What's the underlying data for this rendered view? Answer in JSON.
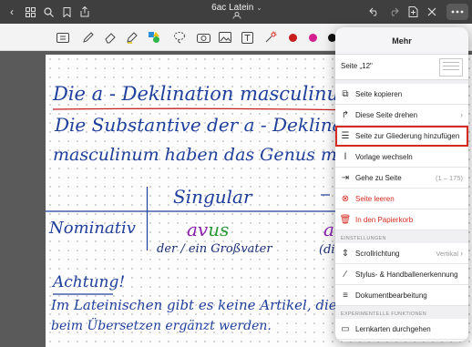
{
  "app": {
    "title": "6ac Latein",
    "title_caret": "⌄",
    "subtitle_icon": "cloud-person-icon"
  },
  "topbar": {
    "left_icons": [
      "back-icon",
      "grid-icon",
      "search-icon",
      "bookmark-icon",
      "share-icon"
    ],
    "right_icons": [
      "undo-icon",
      "redo-icon",
      "add-page-icon",
      "close-icon",
      "more-icon"
    ]
  },
  "toolbar": {
    "tools": [
      "read-mode-icon",
      "pen-icon",
      "eraser-icon",
      "highlighter-icon",
      "shape-icon",
      "lasso-icon",
      "camera-icon",
      "image-icon",
      "text-icon",
      "laser-icon"
    ],
    "colors": [
      "#c81e1e",
      "#d41f8f",
      "#111111"
    ]
  },
  "note": {
    "line1": "Die a - Deklination masculinum",
    "line2": "Die Substantive der a - Deklina",
    "line3": "masculinum haben das Genus ma",
    "singular": "Singular",
    "nominativ": "Nominativ",
    "word": "avus",
    "word_stem": "av",
    "word_ending": "us",
    "word2": "a",
    "translation": "der / ein Großvater",
    "translation2": "(di",
    "achtung": "Achtung!",
    "line_a1": "Im Lateinischen gibt es keine Artikel, die",
    "line_a2": "beim Übersetzen ergänzt werden."
  },
  "menu": {
    "title": "Mehr",
    "page_label": "Seite „12\"",
    "items": [
      {
        "icon": "copy-icon",
        "label": "Seite kopieren"
      },
      {
        "icon": "rotate-icon",
        "label": "Diese Seite drehen",
        "chevron": "›"
      },
      {
        "icon": "outline-icon",
        "label": "Seite zur Gliederung hinzufügen"
      },
      {
        "icon": "template-icon",
        "label": "Vorlage wechseln"
      },
      {
        "icon": "goto-icon",
        "label": "Gehe zu Seite",
        "meta": "(1 – 175)"
      },
      {
        "icon": "clear-icon",
        "label": "Seite leeren"
      },
      {
        "icon": "trash-icon",
        "label": "In den Papierkorb"
      }
    ],
    "section_settings": "EINSTELLUNGEN",
    "settings_items": [
      {
        "icon": "scroll-icon",
        "label": "Scrollrichtung",
        "meta": "Vertikal",
        "chevron": "›"
      },
      {
        "icon": "stylus-icon",
        "label": "Stylus- & Handballenerkennung"
      },
      {
        "icon": "doc-edit-icon",
        "label": "Dokumentbearbeitung"
      }
    ],
    "section_experimental": "EXPERIMENTELLE FUNKTIONEN",
    "experimental_items": [
      {
        "icon": "flashcards-icon",
        "label": "Lernkarten durchgehen"
      }
    ]
  }
}
